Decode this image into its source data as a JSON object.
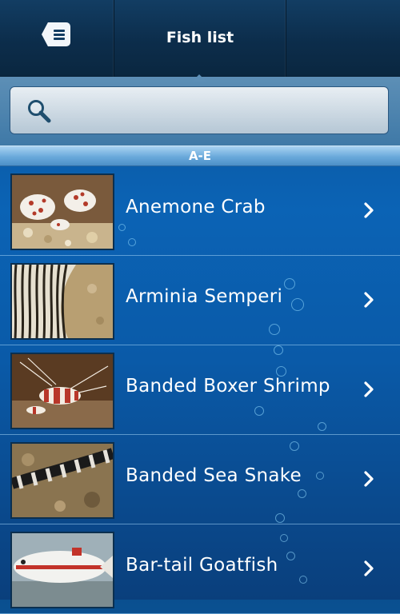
{
  "nav": {
    "title": "Fish list",
    "menu_icon": "menu-icon"
  },
  "search": {
    "placeholder": "",
    "icon": "search-icon"
  },
  "section": {
    "label": "A-E"
  },
  "fish": [
    {
      "name": "Anemone Crab",
      "icon": "chevron-right-icon"
    },
    {
      "name": "Arminia Semperi",
      "icon": "chevron-right-icon"
    },
    {
      "name": "Banded Boxer Shrimp",
      "icon": "chevron-right-icon"
    },
    {
      "name": "Banded Sea Snake",
      "icon": "chevron-right-icon"
    },
    {
      "name": "Bar-tail Goatfish",
      "icon": "chevron-right-icon"
    }
  ],
  "colors": {
    "navbar": "#0c2d4b",
    "list_background": "#0b63b5",
    "section_header": "#6aa9db",
    "text": "#ffffff"
  }
}
